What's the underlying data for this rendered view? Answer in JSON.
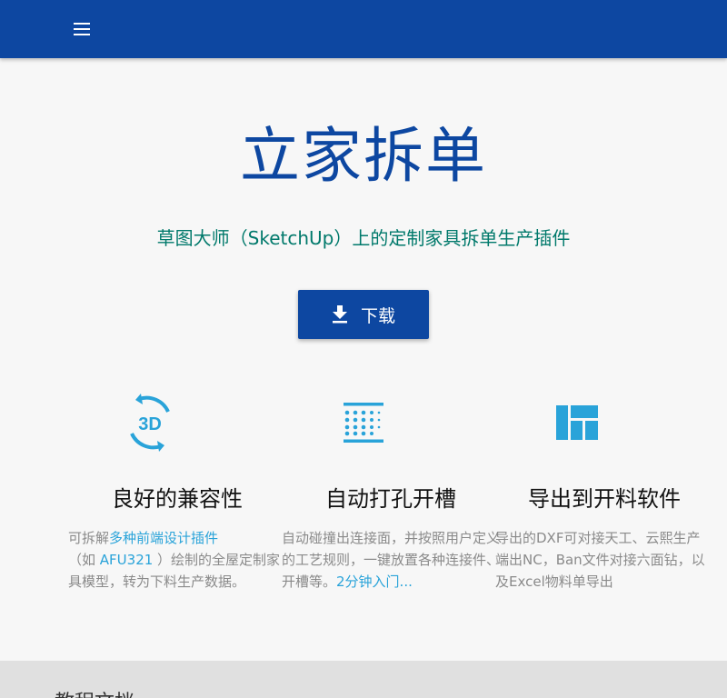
{
  "topbar": {
    "menu_icon": "menu-icon"
  },
  "hero": {
    "title": "立家拆单",
    "subtitle": "草图大师（SketchUp）上的定制家具拆单生产插件",
    "download_label": "下载",
    "download_icon": "download-icon"
  },
  "features": [
    {
      "icon": "3d-rotation-icon",
      "title": "良好的兼容性",
      "text_before": "可拆解",
      "link1": "多种前端设计插件",
      "text_mid": "（如 ",
      "link2": "AFU321",
      "text_after": " ）绘制的全屋定制家具模型，转为下料生产数据。"
    },
    {
      "icon": "dots-grid-icon",
      "title": "自动打孔开槽",
      "text": "自动碰撞出连接面，并按照用户定义的工艺规则，一键放置各种连接件、开槽等。",
      "link": "2分钟入门..."
    },
    {
      "icon": "panels-icon",
      "title": "导出到开料软件",
      "text": "导出的DXF可对接天工、云熙生产端出NC，Ban文件对接六面钻，以及Excel物料单导出"
    }
  ],
  "bottom": {
    "peek_title": "教程文档"
  },
  "colors": {
    "primary": "#0d47a1",
    "accent": "#29a3d9",
    "teal": "#00796b"
  }
}
